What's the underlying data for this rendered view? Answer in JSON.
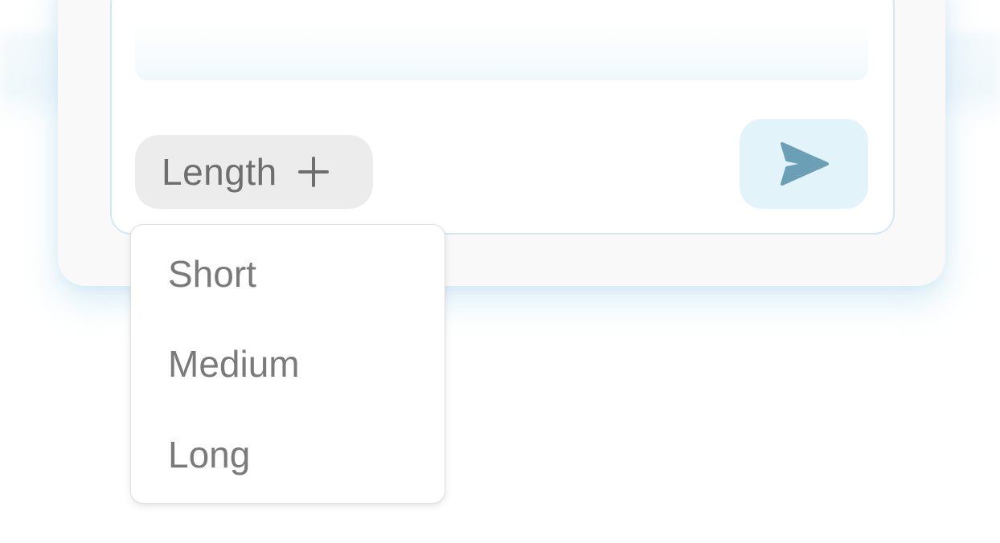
{
  "composer": {
    "length_chip": {
      "label": "Length",
      "icon": "plus-icon"
    },
    "send_button": {
      "icon": "send-icon",
      "icon_color": "#6a9fb5",
      "background": "#e2f3fa"
    }
  },
  "length_dropdown": {
    "options": [
      {
        "label": "Short"
      },
      {
        "label": "Medium"
      },
      {
        "label": "Long"
      }
    ]
  }
}
